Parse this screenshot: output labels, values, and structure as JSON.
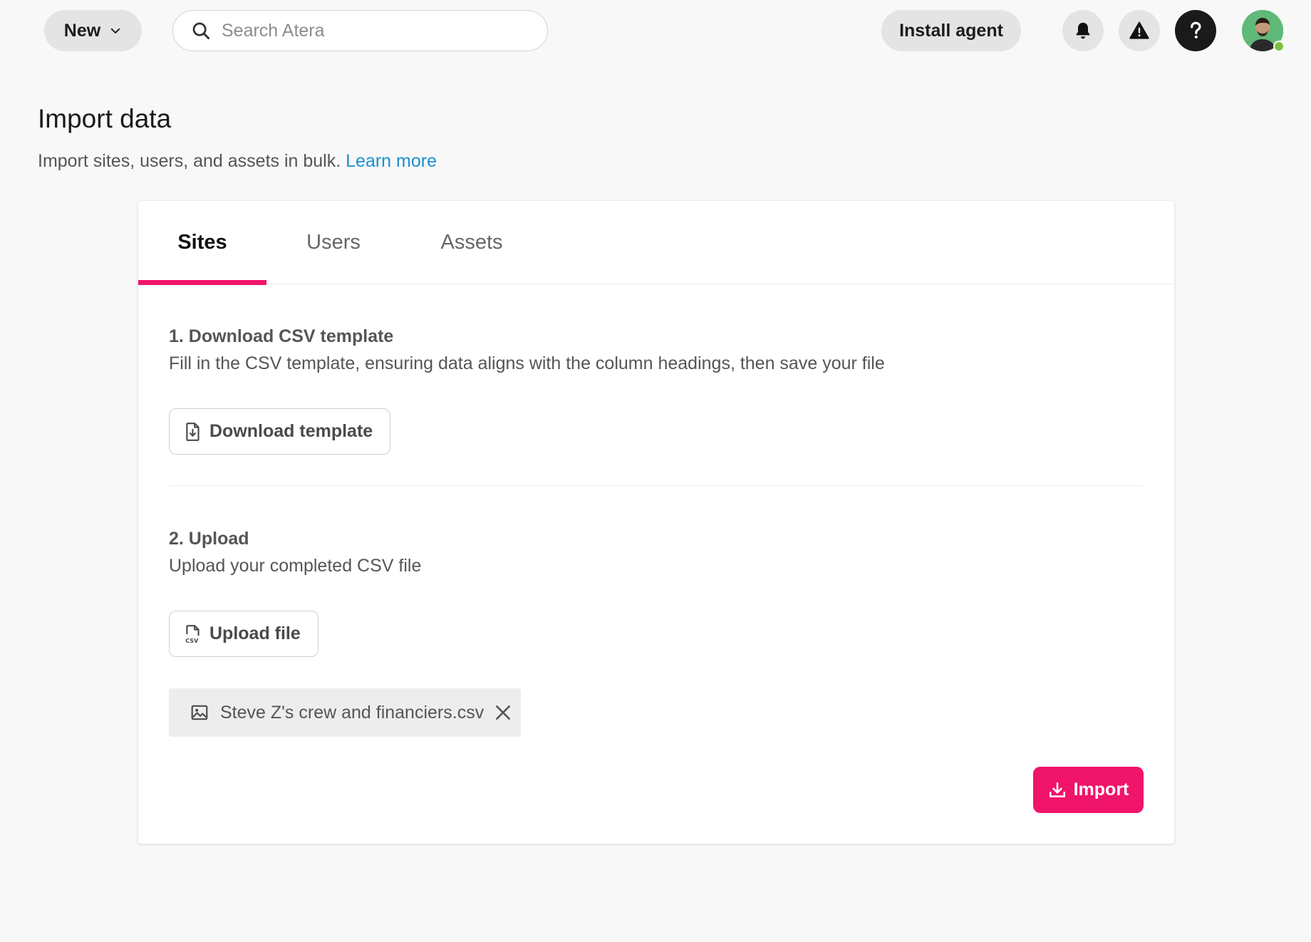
{
  "topbar": {
    "new_label": "New",
    "search_placeholder": "Search Atera",
    "install_agent_label": "Install agent",
    "help_glyph": "?"
  },
  "page": {
    "title": "Import data",
    "subtitle": "Import sites, users, and assets in bulk.",
    "learn_more": "Learn more"
  },
  "tabs": [
    {
      "label": "Sites",
      "active": true
    },
    {
      "label": "Users",
      "active": false
    },
    {
      "label": "Assets",
      "active": false
    }
  ],
  "step1": {
    "title": "1. Download CSV template",
    "description": "Fill in the CSV template, ensuring data aligns with the column headings, then save your file",
    "button_label": "Download template"
  },
  "step2": {
    "title": "2. Upload",
    "description": "Upload your completed CSV file",
    "button_label": "Upload file"
  },
  "uploaded_file": {
    "name": "Steve Z's crew and financiers.csv"
  },
  "import_label": "Import",
  "colors": {
    "accent": "#f0146a",
    "link": "#1a8fd1",
    "presence": "#7cc13c"
  },
  "icons": [
    "chevron-down-icon",
    "search-icon",
    "bell-icon",
    "warning-icon",
    "help-icon",
    "file-download-icon",
    "csv-file-icon",
    "image-icon",
    "close-icon",
    "import-icon"
  ]
}
